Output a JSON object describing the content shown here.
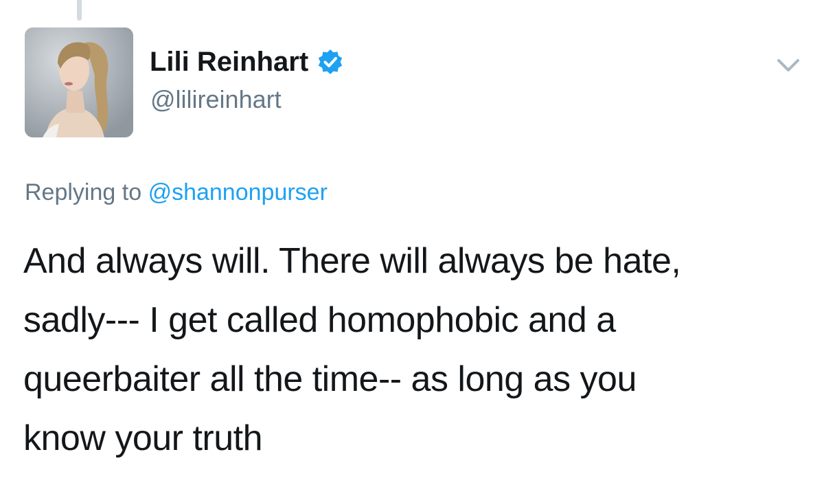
{
  "tweet": {
    "author": {
      "display_name": "Lili Reinhart",
      "handle": "@lilireinhart",
      "verified": true,
      "verified_icon": "verified-badge-icon",
      "avatar": "profile-photo"
    },
    "menu_icon": "chevron-down-icon",
    "replying_to": {
      "prefix": "Replying to",
      "mention": "@shannonpurser"
    },
    "text_lines": [
      "And always will. There will always be hate,",
      "sadly--- I get called homophobic and a",
      "queerbaiter all the time-- as long as you",
      "know your truth"
    ]
  },
  "colors": {
    "text_primary": "#14171a",
    "text_secondary": "#657786",
    "link": "#1da1f2",
    "verified": "#1da1f2",
    "thread_line": "#d3dae0"
  }
}
